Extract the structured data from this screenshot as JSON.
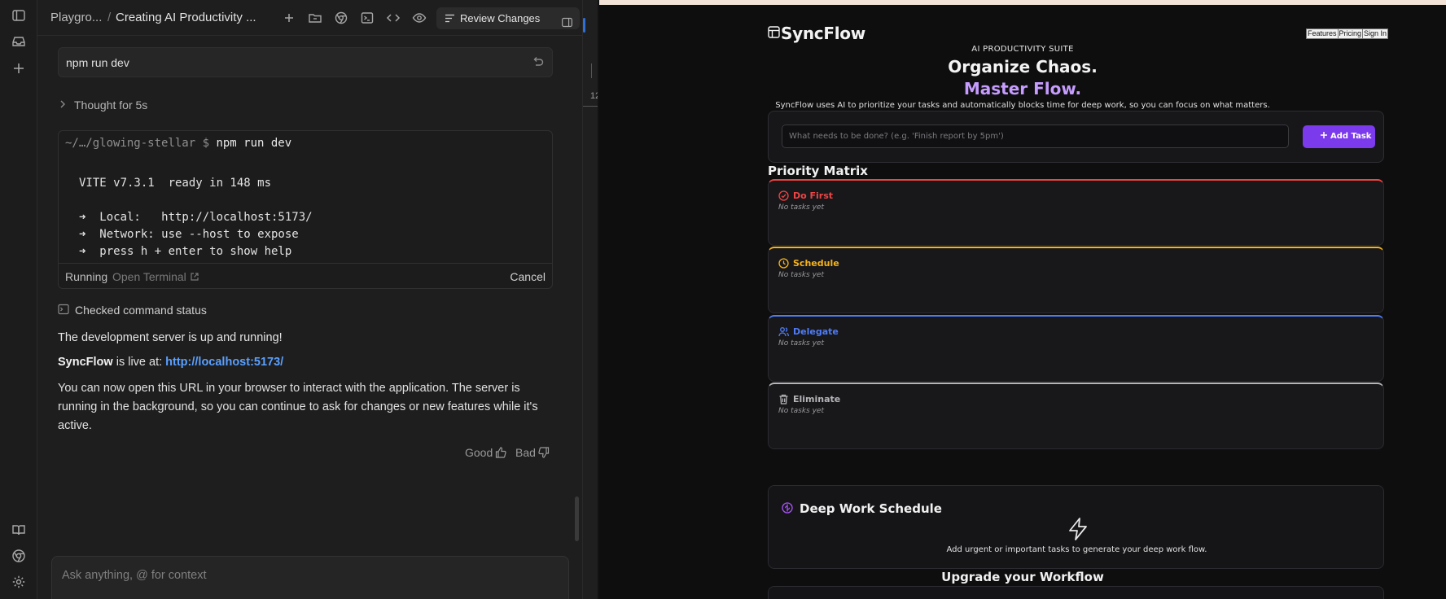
{
  "rail": {
    "icons": [
      "sidebar-toggle-icon",
      "inbox-icon",
      "plus-icon",
      "book-icon",
      "chrome-icon",
      "settings-icon"
    ]
  },
  "chat": {
    "breadcrumb": {
      "project": "Playgro...",
      "separator": "/",
      "conversation": "Creating AI Productivity ..."
    },
    "toolbar": {
      "review_label": "Review Changes"
    },
    "command": {
      "text": "npm run dev"
    },
    "thought": {
      "label": "Thought for 5s"
    },
    "terminal": {
      "prompt_path": "~/…/glowing-stellar $",
      "prompt_cmd": "npm run dev",
      "lines": [
        "VITE v7.3.1  ready in 148 ms",
        "➜  Local:   http://localhost:5173/",
        "➜  Network: use --host to expose",
        "➜  press h + enter to show help"
      ],
      "status": "Running",
      "open_label": "Open Terminal",
      "cancel_label": "Cancel"
    },
    "checked_label": "Checked command status",
    "message": {
      "p1": "The development server is up and running!",
      "app_name": "SyncFlow",
      "live_at": " is live at: ",
      "url": "http://localhost:5173/",
      "p3": "You can now open this URL in your browser to interact with the application. The server is running in the background, so you can continue to ask for changes or new features while it's active."
    },
    "feedback": {
      "good": "Good",
      "bad": "Bad"
    },
    "input": {
      "placeholder": "Ask anything, @ for context"
    }
  },
  "middle": {
    "line_number": "12"
  },
  "preview": {
    "brand": "SyncFlow",
    "nav": [
      "Features",
      "Pricing",
      "Sign In"
    ],
    "eyebrow": "AI PRODUCTIVITY SUITE",
    "headline1": "Organize Chaos.",
    "headline2": "Master Flow.",
    "subtitle": "SyncFlow uses AI to prioritize your tasks and automatically blocks time for deep work, so you can focus on what matters.",
    "task_input": {
      "placeholder": "What needs to be done? (e.g. 'Finish report by 5pm')"
    },
    "add_task_label": "Add Task",
    "matrix_title": "Priority Matrix",
    "quadrants": [
      {
        "title": "Do First",
        "empty": "No tasks yet",
        "color": "#ef4444",
        "icon": "check-circle-icon"
      },
      {
        "title": "Schedule",
        "empty": "No tasks yet",
        "color": "#f5b31b",
        "icon": "clock-icon"
      },
      {
        "title": "Delegate",
        "empty": "No tasks yet",
        "color": "#4f7cf6",
        "icon": "users-icon"
      },
      {
        "title": "Eliminate",
        "empty": "No tasks yet",
        "color": "#b5b5b9",
        "icon": "trash-icon"
      }
    ],
    "deep_work": {
      "title": "Deep Work Schedule",
      "message": "Add urgent or important tasks to generate your deep work flow."
    },
    "upgrade_title": "Upgrade your Workflow",
    "colors": {
      "accent": "#7c3aed",
      "accent_text": "#c69cff"
    }
  }
}
